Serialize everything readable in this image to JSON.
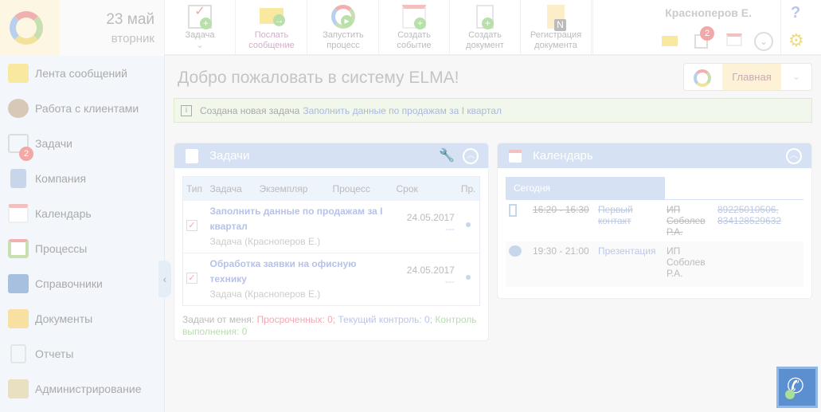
{
  "header": {
    "day": "23 май",
    "weekday": "вторник",
    "user": "Красноперов Е.",
    "task_badge": "2",
    "help": "?"
  },
  "toolbar": [
    {
      "label": "Задача"
    },
    {
      "label": "Послать сообщение"
    },
    {
      "label": "Запустить процесс"
    },
    {
      "label": "Создать событие"
    },
    {
      "label": "Создать документ"
    },
    {
      "label": "Регистрация документа"
    }
  ],
  "sidebar": {
    "items": [
      {
        "label": "Лента сообщений"
      },
      {
        "label": "Работа с клиентами"
      },
      {
        "label": "Задачи",
        "badge": "2"
      },
      {
        "label": "Компания"
      },
      {
        "label": "Календарь"
      },
      {
        "label": "Процессы"
      },
      {
        "label": "Справочники"
      },
      {
        "label": "Документы"
      },
      {
        "label": "Отчеты"
      },
      {
        "label": "Администрирование"
      }
    ]
  },
  "main": {
    "welcome": "Добро пожаловать в систему ELMA!",
    "home": "Главная",
    "notice": {
      "text": "Создана новая задача",
      "link": "Заполнить данные по продажам за I квартал"
    }
  },
  "tasks": {
    "title": "Задачи",
    "columns": [
      "Тип",
      "Задача",
      "Экземпляр",
      "Процесс",
      "Срок",
      "Пр."
    ],
    "rows": [
      {
        "title": "Заполнить данные по продажам за I квартал",
        "sub": "Задача (Красноперов Е.)",
        "date": "24.05.2017",
        "dash": "---"
      },
      {
        "title": "Обработка заявки на офисную технику",
        "sub": "Задача (Красноперов Е.)",
        "date": "24.05.2017",
        "dash": "---"
      }
    ],
    "footer": {
      "prefix": "Задачи от меня:",
      "overdue": "Просроченных: 0;",
      "current": "Текущий контроль: 0;",
      "control": "Контроль выполнения: 0"
    }
  },
  "calendar": {
    "title": "Календарь",
    "tab": "Сегодня",
    "events": [
      {
        "time": "16:20 - 16:30",
        "name": "Первый контакт",
        "who": "ИП Соболев Р.А.",
        "phone": "89225010506, 834128529632",
        "done": true
      },
      {
        "time": "19:30 - 21:00",
        "name": "Презентация",
        "who": "ИП Соболев Р.А.",
        "phone": "",
        "done": false
      }
    ]
  }
}
